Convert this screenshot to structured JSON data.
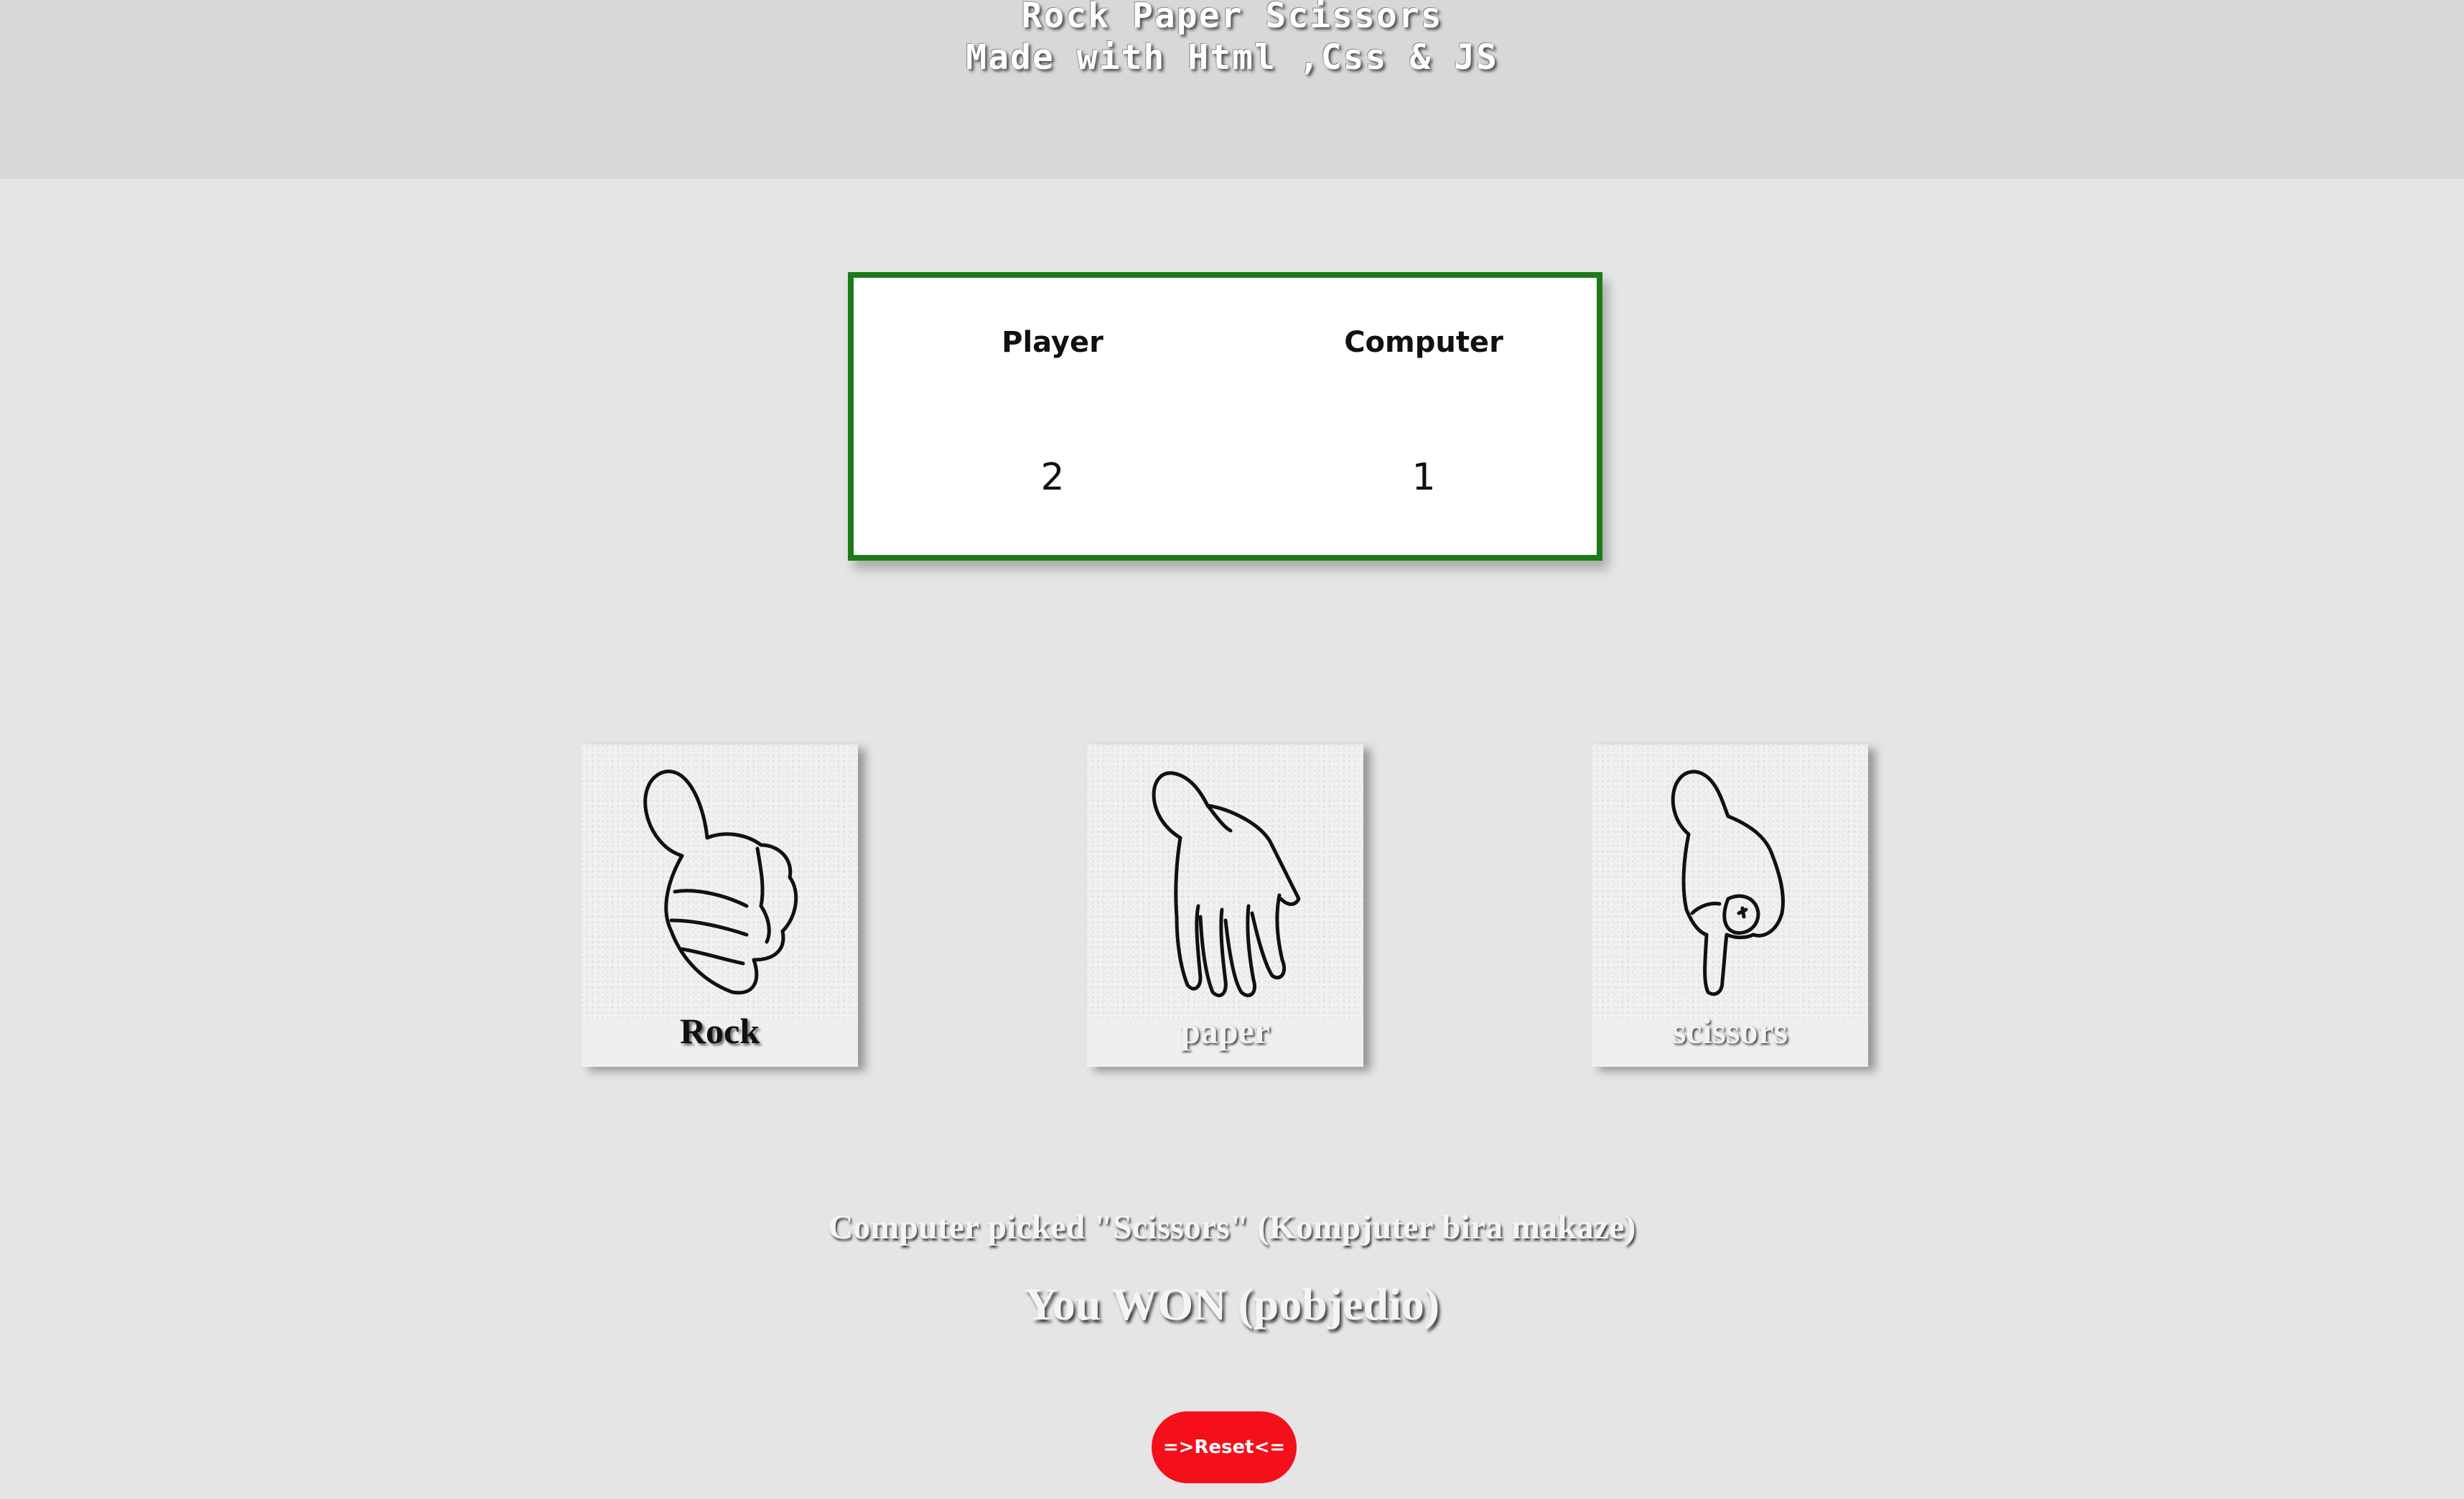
{
  "header": {
    "title": "Rock Paper Scissors",
    "subtitle": "Made with Html ,Css & JS"
  },
  "scoreboard": {
    "player_label": "Player",
    "computer_label": "Computer",
    "player_score": "2",
    "computer_score": "1",
    "border_color": "#1d7a1a"
  },
  "choices": [
    {
      "label": "Rock",
      "icon": "fist-hand-icon"
    },
    {
      "label": "paper",
      "icon": "open-hand-icon"
    },
    {
      "label": "scissors",
      "icon": "two-finger-hand-icon"
    }
  ],
  "result": {
    "computer_pick": "Computer picked \"Scissors\" (Kompjuter bira makaze)",
    "outcome": "You WON (pobjedio)"
  },
  "reset_button": {
    "label": "=>Reset<=",
    "color": "#f40f1b"
  }
}
